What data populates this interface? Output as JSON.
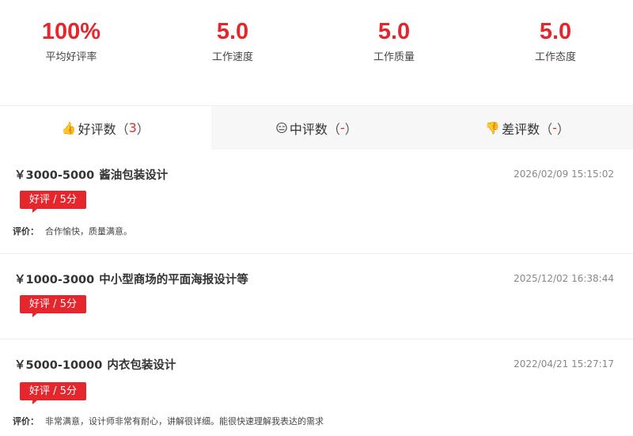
{
  "stats": [
    {
      "value": "100%",
      "label": "平均好评率"
    },
    {
      "value": "5.0",
      "label": "工作速度"
    },
    {
      "value": "5.0",
      "label": "工作质量"
    },
    {
      "value": "5.0",
      "label": "工作态度"
    }
  ],
  "tabs": [
    {
      "icon": "thumbs-up-icon",
      "label": "好评数",
      "count": "3"
    },
    {
      "icon": "neutral-face-icon",
      "label": "中评数",
      "count": "-"
    },
    {
      "icon": "thumbs-down-icon",
      "label": "差评数",
      "count": "-"
    }
  ],
  "common": {
    "paren_open": "（",
    "paren_close": "）",
    "review_label": "评价："
  },
  "reviews": [
    {
      "price": "￥3000-5000",
      "title": "酱油包装设计",
      "date": "2026/02/09 15:15:02",
      "tag": "好评 / 5分",
      "text": "合作愉快，质量满意。"
    },
    {
      "price": "￥1000-3000",
      "title": "中小型商场的平面海报设计等",
      "date": "2025/12/02 16:38:44",
      "tag": "好评 / 5分",
      "text": ""
    },
    {
      "price": "￥5000-10000",
      "title": "内衣包装设计",
      "date": "2022/04/21 15:27:17",
      "tag": "好评 / 5分",
      "text": "非常满意，设计师非常有耐心，讲解很详细。能很快速理解我表达的需求"
    }
  ],
  "colors": {
    "accent": "#e5262c",
    "tab_inactive_bg": "#f7f7f7"
  }
}
